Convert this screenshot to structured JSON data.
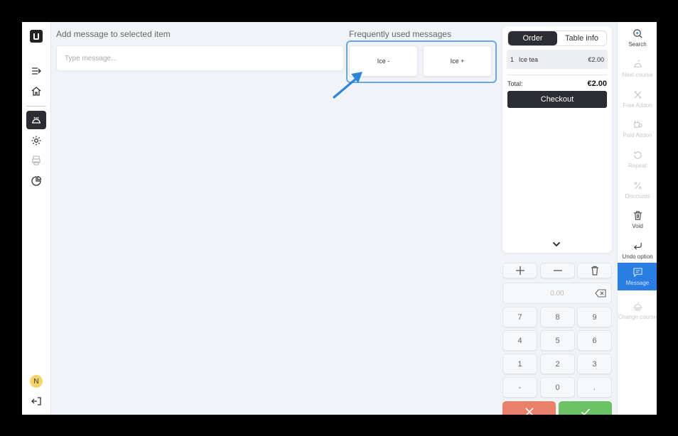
{
  "message_panel": {
    "title": "Add message to selected item",
    "input_placeholder": "Type message...",
    "input_value": ""
  },
  "frequent_messages": {
    "title": "Frequently used messages",
    "items": [
      "Ice -",
      "Ice +"
    ]
  },
  "left_nav": {
    "avatar_initial": "N",
    "icons": [
      "logo-icon",
      "collapse-menu-icon",
      "home-icon",
      "orders-icon",
      "settings-icon",
      "printer-icon",
      "reports-icon",
      "logout-icon"
    ]
  },
  "order": {
    "tabs": [
      {
        "label": "Order",
        "active": true
      },
      {
        "label": "Table info",
        "active": false
      }
    ],
    "items": [
      {
        "qty": "1",
        "name": "Ice tea",
        "price": "€2.00"
      }
    ],
    "total_label": "Total:",
    "total_value": "€2.00",
    "checkout_label": "Checkout"
  },
  "keypad": {
    "display": "0.00",
    "keys": [
      "7",
      "8",
      "9",
      "4",
      "5",
      "6",
      "1",
      "2",
      "3",
      "-",
      "0",
      "."
    ]
  },
  "toolbar": [
    {
      "label": "Search",
      "icon": "search-icon",
      "enabled": true,
      "active": false
    },
    {
      "label": "Next course",
      "icon": "next-course-icon",
      "enabled": false,
      "active": false
    },
    {
      "label": "Free Addon",
      "icon": "free-addon-icon",
      "enabled": false,
      "active": false
    },
    {
      "label": "Paid Addon",
      "icon": "paid-addon-icon",
      "enabled": false,
      "active": false
    },
    {
      "label": "Repeat",
      "icon": "repeat-icon",
      "enabled": false,
      "active": false
    },
    {
      "label": "Discounts",
      "icon": "percent-icon",
      "enabled": false,
      "active": false
    },
    {
      "label": "Void",
      "icon": "trash-icon",
      "enabled": true,
      "active": false
    },
    {
      "label": "Undo option",
      "icon": "undo-icon",
      "enabled": true,
      "active": false
    },
    {
      "label": "Message",
      "icon": "message-icon",
      "enabled": true,
      "active": true
    },
    {
      "label": "Change course",
      "icon": "change-course-icon",
      "enabled": false,
      "active": false
    }
  ],
  "colors": {
    "accent": "#2a7de1",
    "dark": "#2b2d33",
    "cancel": "#e8806a",
    "confirm": "#6cc066",
    "highlight": "#6aa6e6"
  }
}
